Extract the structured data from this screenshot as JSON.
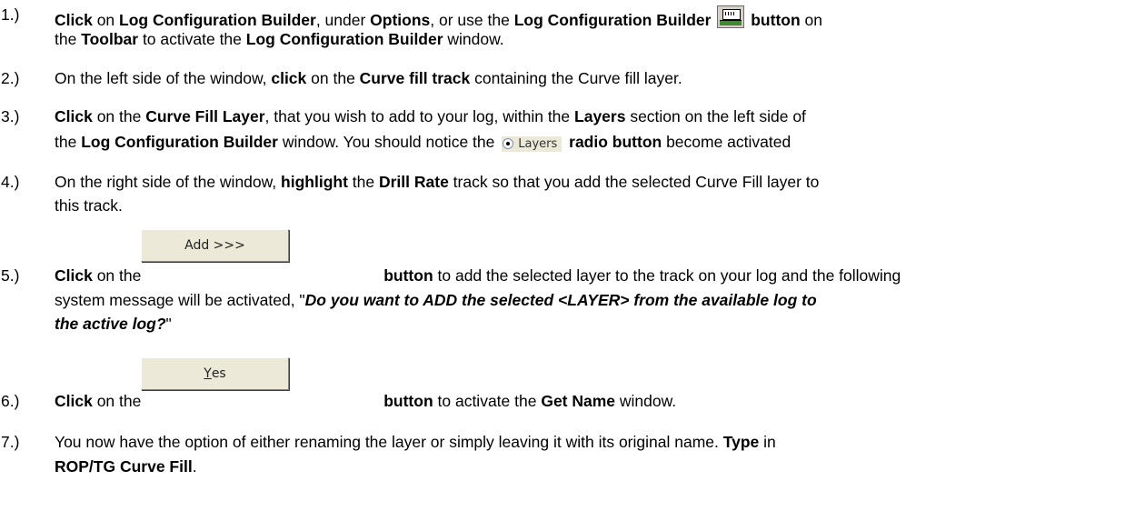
{
  "steps": [
    {
      "num": "1.)",
      "l1": {
        "b1": "Click",
        "t1": " on ",
        "b2": "Log Configuration Builder",
        "t2": ", under ",
        "b3": "Options",
        "t3": ", or use the ",
        "b4": "Log Configuration Builder",
        "b5": "button",
        "t5": " on"
      },
      "l2": {
        "t1": "the ",
        "b1": "Toolbar",
        "t2": " to activate the ",
        "b2": "Log Configuration Builder",
        "t3": " window."
      }
    },
    {
      "num": "2.)",
      "l1": {
        "t1": "On the left side of the window, ",
        "b1": "click",
        "t2": " on the ",
        "b2": "Curve fill track",
        "t3": " containing the Curve fill layer."
      }
    },
    {
      "num": "3.)",
      "l1": {
        "b1": "Click",
        "t1": " on the ",
        "b2": "Curve Fill Layer",
        "t2": ", that you wish to add to your log, within the ",
        "b3": "Layers",
        "t3": " section on the left side of"
      },
      "l2": {
        "t1": "the ",
        "b1": "Log Configuration Builder",
        "t2": " window. You should notice the ",
        "radio": "Layers",
        "b2": "radio button",
        "t3": " become activated"
      }
    },
    {
      "num": "4.)",
      "l1": {
        "t1": "On the right side of the window, ",
        "b1": "highlight",
        "t2": " the ",
        "b2": "Drill Rate",
        "t3": " track so that you add the selected Curve Fill layer to"
      },
      "l2": {
        "t1": "this track."
      }
    },
    {
      "num": "5.)",
      "l1": {
        "b1": "Click",
        "t1": " on the ",
        "button": "Add >>>",
        "b2": "button",
        "t2": " to add the selected layer to the track on your log and the following"
      },
      "l2": {
        "t1": "system message will be activated, \"",
        "bi1": "Do you want to ADD the selected <LAYER> from the available log to"
      },
      "l3": {
        "bi1": "the active log?",
        "t1": "\""
      }
    },
    {
      "num": "6.)",
      "l1": {
        "b1": "Click",
        "t1": " on the ",
        "button_ul": "Y",
        "button_rest": "es",
        "b2": "button",
        "t2": " to activate the ",
        "b3": "Get Name",
        "t3": " window."
      }
    },
    {
      "num": "7.)",
      "l1": {
        "t1": "You now have the option of either renaming the layer or simply leaving it with its original name. ",
        "b1": "Type",
        "t2": " in"
      },
      "l2": {
        "b1": "ROP/TG Curve Fill",
        "t1": "."
      }
    }
  ]
}
